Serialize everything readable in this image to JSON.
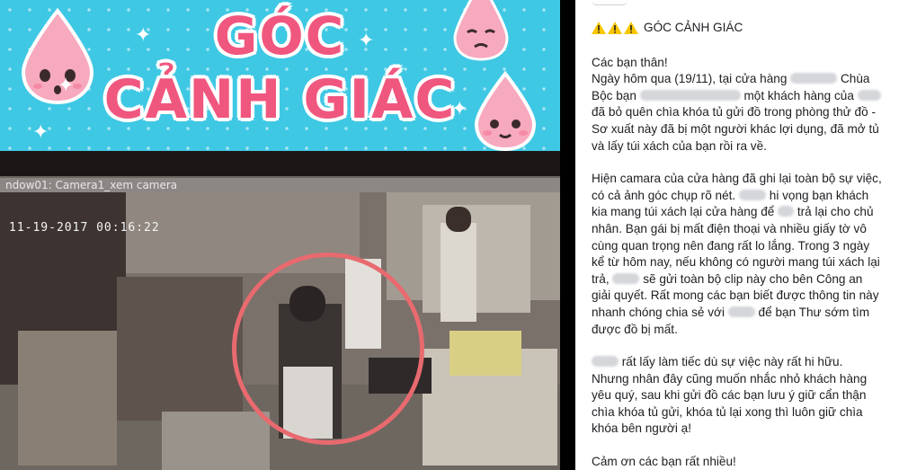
{
  "banner": {
    "line1": "GÓC",
    "line2": "CẢNH GIÁC"
  },
  "cctv": {
    "window_label": "ndow01: Camera1_xem camera",
    "timestamp": "11-19-2017 00:16:22"
  },
  "post": {
    "title": "GÓC CẢNH GIÁC",
    "greeting": "Các bạn thân!",
    "p1_a": "Ngày hôm qua (19/11), tại cửa hàng",
    "p1_b": "Chùa Bộc bạn",
    "p1_c": "một khách hàng của",
    "p1_d": "đã bỏ quên chìa khóa tủ gửi đồ trong phòng thử đồ - Sơ xuất này đã bị một người khác lợi dụng, đã mở tủ và lấy túi xách của bạn rồi ra về.",
    "p2_a": "Hiện camara của cửa hàng đã ghi lại toàn bộ sự việc, có cả ảnh góc chụp rõ nét.",
    "p2_b": "hi vọng bạn khách kia mang túi xách lại cửa hàng để",
    "p2_c": "trả lại cho chủ nhân. Bạn gái bị mất điện thoại và nhiều giấy tờ vô cùng quan trọng nên đang rất lo lắng.",
    "p2_d": "Trong 3 ngày kể từ hôm nay, nếu không có người mang túi xách lại trả,",
    "p2_e": "sẽ gửi toàn bộ clip này cho bên Công an giải quyết. Rất mong các bạn biết được thông tin này nhanh chóng chia sẻ với",
    "p2_f": "để bạn Thư sớm tìm được đồ bị mất.",
    "p3_a": "rất lấy làm tiếc dù sự việc này rất hi hữu. Nhưng nhân đây cũng muốn nhắc nhỏ khách hàng yêu quý, sau khi gửi đồ các bạn lưu ý giữ cẩn thận chìa khóa tủ gửi, khóa tủ lại xong thì luôn giữ chìa khóa bên người ạ!",
    "thanks": "Cảm ơn các bạn rất nhiều!"
  },
  "colors": {
    "banner_bg": "#3fc8e4",
    "banner_text": "#f0577f",
    "circle": "#e86a6f",
    "warning": "#f7c600"
  },
  "icons": [
    "warning-icon",
    "warning-icon",
    "warning-icon",
    "water-drop-mascot"
  ]
}
